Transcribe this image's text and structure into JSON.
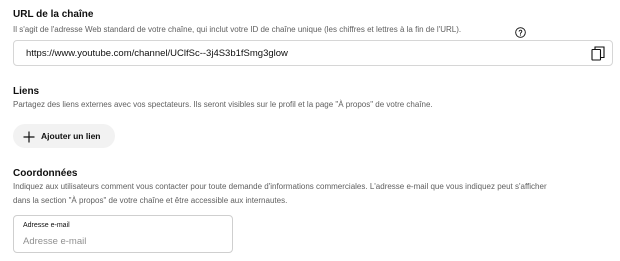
{
  "url_section": {
    "title": "URL de la chaîne",
    "description": "Il s'agit de l'adresse Web standard de votre chaîne, qui inclut votre ID de chaîne unique (les chiffres et lettres à la fin de l'URL).",
    "help_icon": "question-circle",
    "url": "https://www.youtube.com/channel/UClfSc--3j4S3b1fSmg3glow",
    "copy_icon": "copy"
  },
  "links_section": {
    "title": "Liens",
    "description": "Partagez des liens externes avec vos spectateurs. Ils seront visibles sur le profil et la page \"À propos\" de votre chaîne.",
    "add_button_label": "Ajouter un lien",
    "add_icon": "plus"
  },
  "contact_section": {
    "title": "Coordonnées",
    "description_line1": "Indiquez aux utilisateurs comment vous contacter pour toute demande d'informations commerciales. L'adresse e-mail que vous indiquez peut s'afficher",
    "description_line2": "dans la section \"À propos\" de votre chaîne et être accessible aux internautes.",
    "email_label": "Adresse e-mail",
    "email_placeholder": "Adresse e-mail",
    "email_value": ""
  }
}
